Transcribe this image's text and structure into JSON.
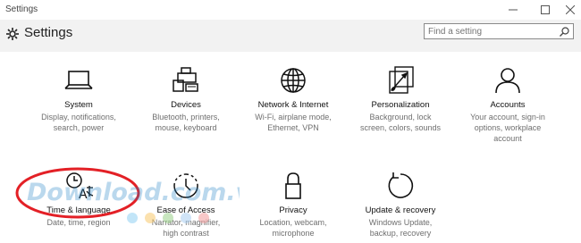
{
  "window": {
    "title": "Settings"
  },
  "header": {
    "title": "Settings"
  },
  "search": {
    "placeholder": "Find a setting"
  },
  "tiles": [
    {
      "label": "System",
      "desc_lines": [
        "Display, notifications,",
        "search, power"
      ],
      "icon": "laptop-icon"
    },
    {
      "label": "Devices",
      "desc_lines": [
        "Bluetooth, printers,",
        "mouse, keyboard"
      ],
      "icon": "devices-icon"
    },
    {
      "label": "Network & Internet",
      "desc_lines": [
        "Wi-Fi, airplane mode,",
        "Ethernet, VPN"
      ],
      "icon": "globe-icon"
    },
    {
      "label": "Personalization",
      "desc_lines": [
        "Background, lock",
        "screen, colors, sounds"
      ],
      "icon": "brush-icon"
    },
    {
      "label": "Accounts",
      "desc_lines": [
        "Your account, sign-in",
        "options, workplace",
        "account"
      ],
      "icon": "person-icon"
    },
    {
      "label": "Time & language",
      "desc_lines": [
        "Date, time, region"
      ],
      "icon": "time-language-icon"
    },
    {
      "label": "Ease of Access",
      "desc_lines": [
        "Narrator, magnifier,",
        "high contrast"
      ],
      "icon": "ease-of-access-icon"
    },
    {
      "label": "Privacy",
      "desc_lines": [
        "Location, webcam,",
        "microphone"
      ],
      "icon": "lock-icon"
    },
    {
      "label": "Update & recovery",
      "desc_lines": [
        "Windows Update,",
        "backup, recovery"
      ],
      "icon": "update-icon"
    }
  ],
  "watermark": {
    "text": "Download.com.vn"
  },
  "colors": {
    "header_bg": "#f2f2f2",
    "annotation": "#e32026",
    "watermark": "#1e7fc4"
  }
}
